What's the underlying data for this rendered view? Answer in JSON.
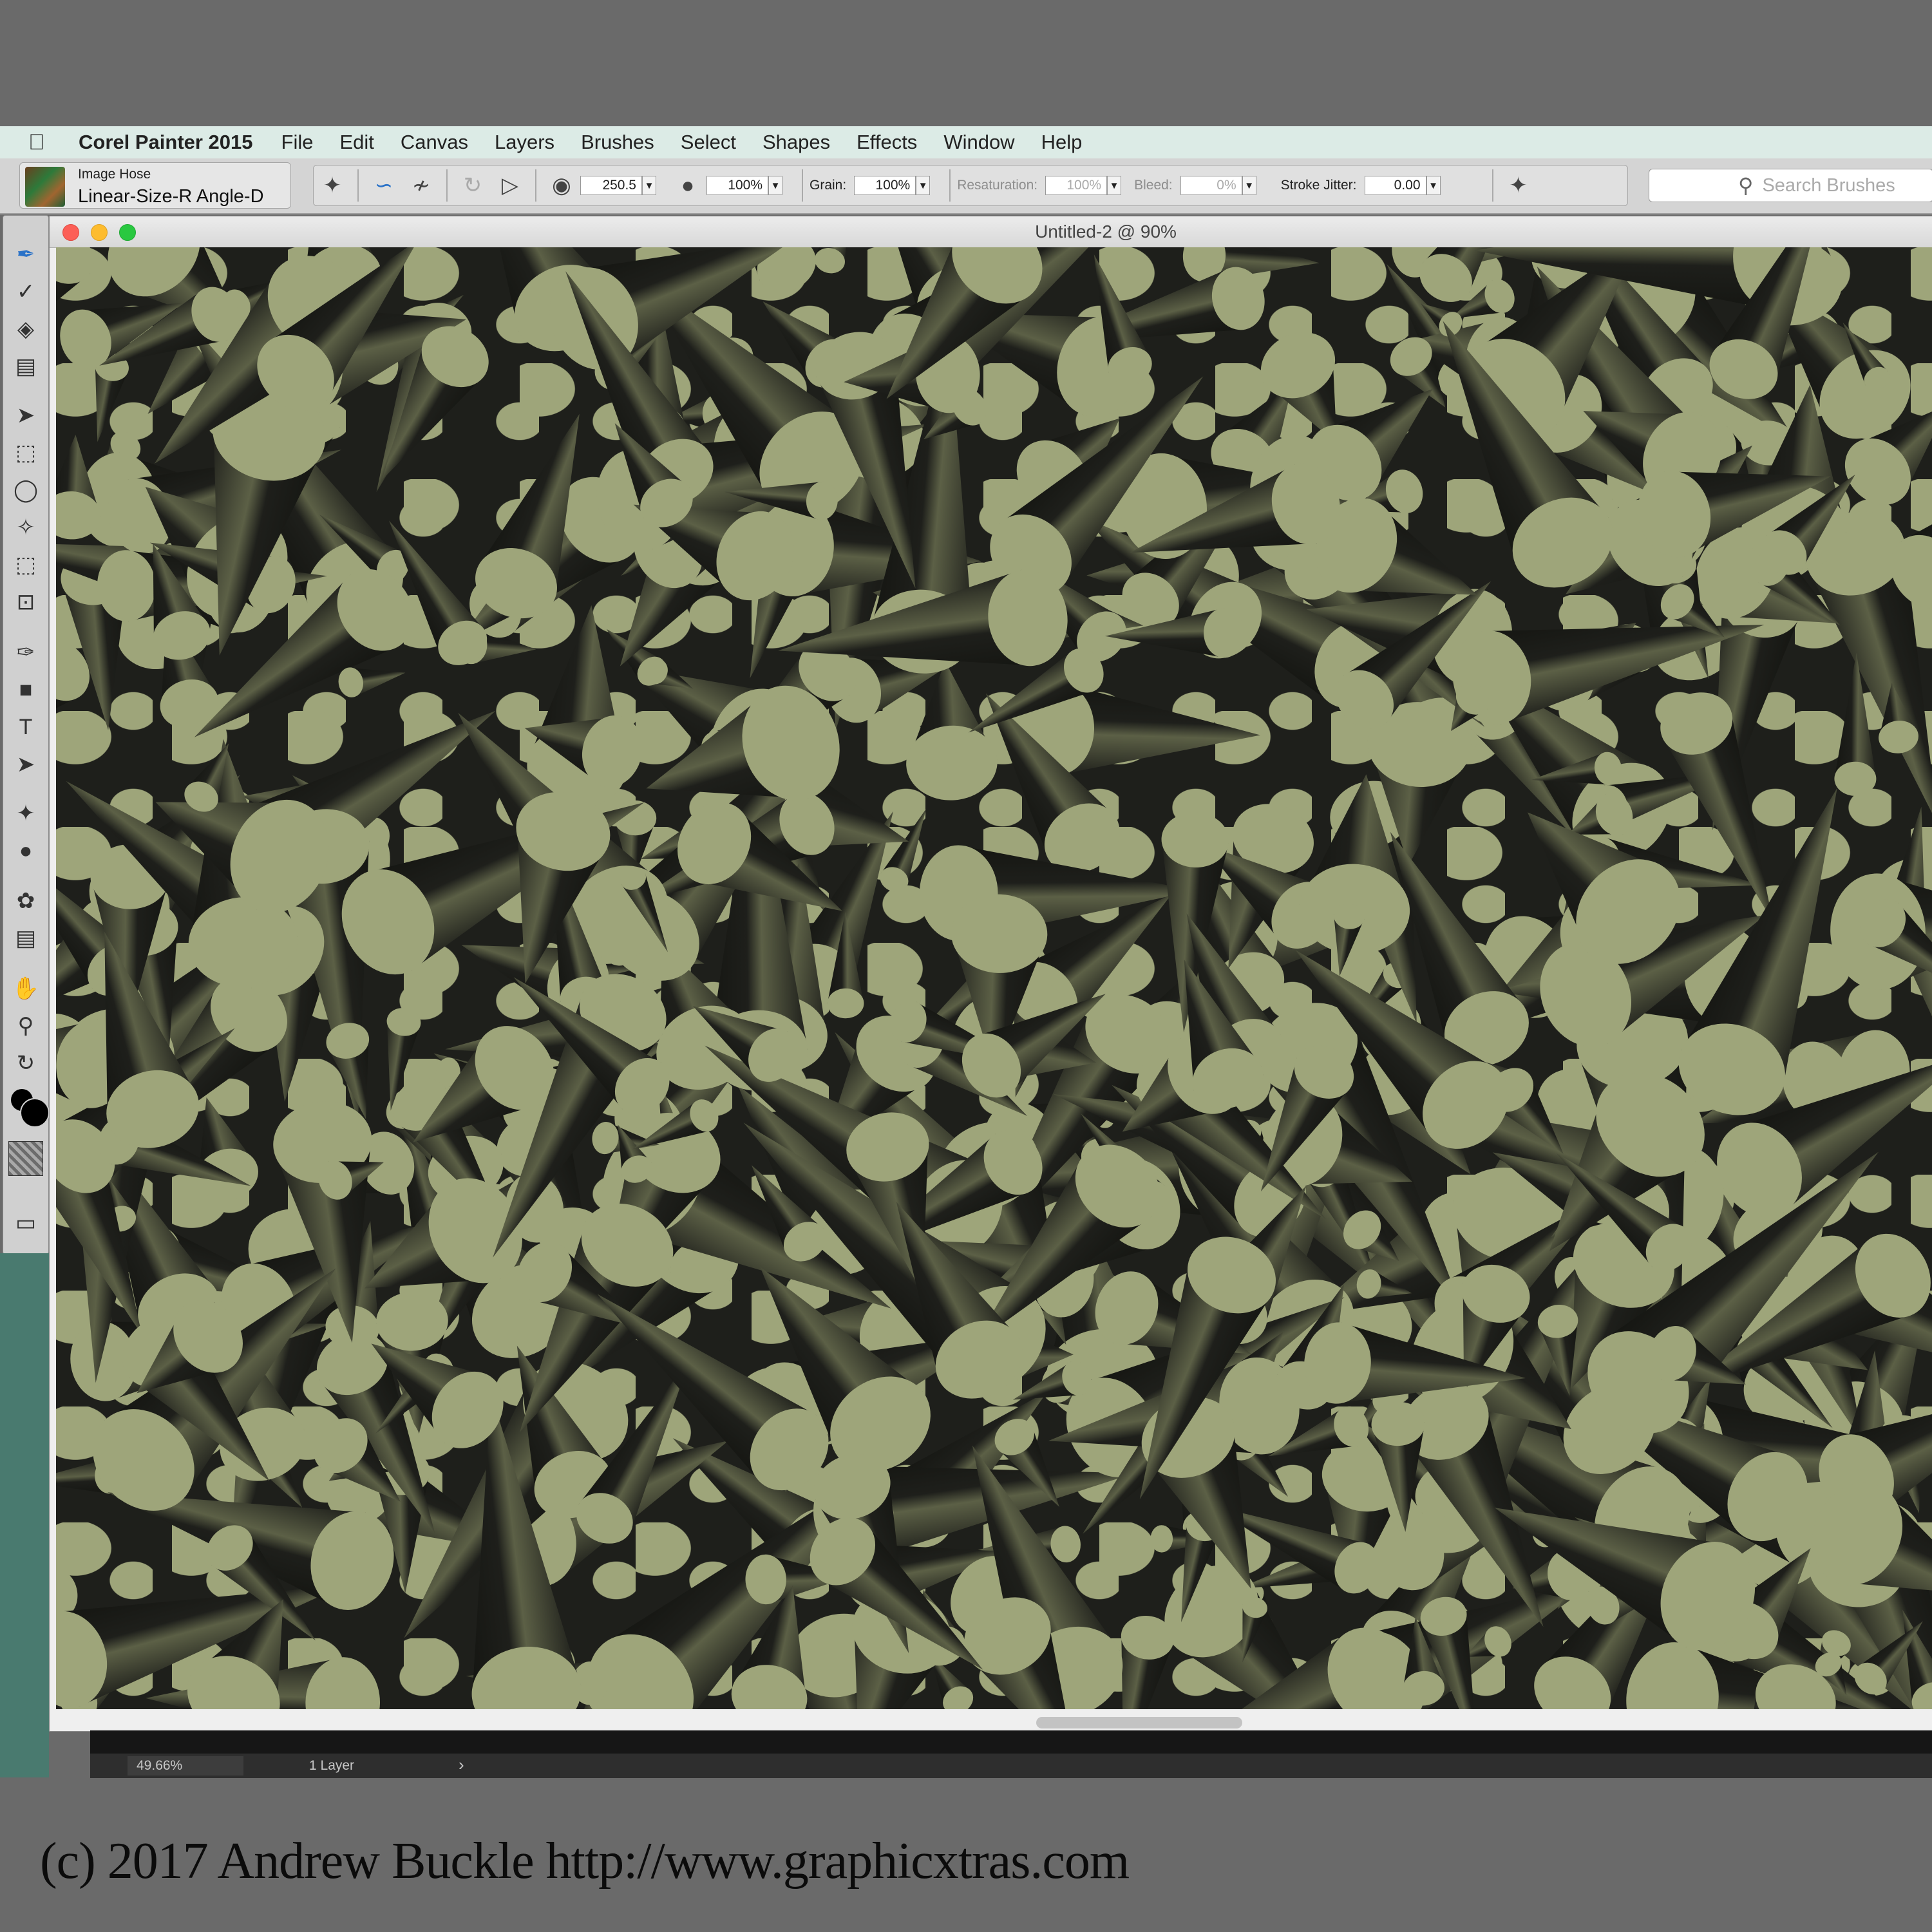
{
  "menubar": {
    "app_name": "Corel Painter 2015",
    "items": [
      "File",
      "Edit",
      "Canvas",
      "Layers",
      "Brushes",
      "Select",
      "Shapes",
      "Effects",
      "Window",
      "Help"
    ]
  },
  "property_bar": {
    "brush_category": "Image Hose",
    "brush_variant": "Linear-Size-R Angle-D",
    "size_value": "250.5",
    "opacity_value": "100%",
    "grain_label": "Grain:",
    "grain_value": "100%",
    "resaturation_label": "Resaturation:",
    "resaturation_value": "100%",
    "bleed_label": "Bleed:",
    "bleed_value": "0%",
    "stroke_jitter_label": "Stroke Jitter:",
    "stroke_jitter_value": "0.00",
    "search_placeholder": "Search Brushes"
  },
  "document": {
    "title": "Untitled-2 @ 90%"
  },
  "status_bar": {
    "zoom": "49.66%",
    "layers": "1 Layer",
    "arrow": "›"
  },
  "colors": {
    "canvas_dark": "#1e1f1b",
    "canvas_light": "#9ea57a",
    "menubar_bg": "#dcebe6",
    "active_tool": "#2a72c8"
  },
  "footer": {
    "copyright": "(c) 2017 Andrew Buckle http://www.graphicxtras.com"
  }
}
